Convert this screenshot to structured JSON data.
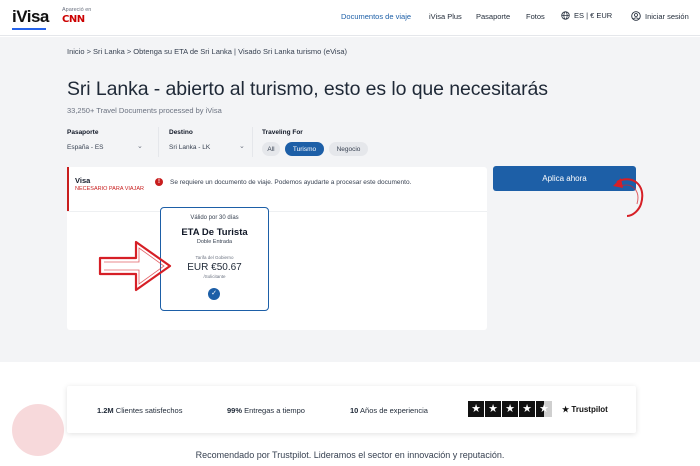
{
  "header": {
    "logo": "iVisa",
    "appeared_in": "Apareció en",
    "cnn": "CNN",
    "nav": [
      "Documentos de viaje",
      "iVisa Plus",
      "Pasaporte",
      "Fotos"
    ],
    "lang_currency": "ES | € EUR",
    "sign_in": "Iniciar sesión"
  },
  "breadcrumb": "Inicio > Sri Lanka > Obtenga su ETA de Sri Lanka | Visado Sri Lanka turismo (eVisa)",
  "page": {
    "title": "Sri Lanka - abierto al turismo, esto es lo que necesitarás",
    "subtitle": "33,250+ Travel Documents processed by iVisa"
  },
  "filters": {
    "passport_label": "Pasaporte",
    "passport_value": "España - ES",
    "destination_label": "Destino",
    "destination_value": "Sri Lanka - LK",
    "traveling_label": "Traveling For",
    "purposes": [
      "All",
      "Turismo",
      "Negocio"
    ],
    "selected_purpose": "Turismo"
  },
  "visa_card": {
    "title": "Visa",
    "required": "NECESARIO PARA VIAJAR",
    "alert": "Se requiere un documento de viaje. Podemos ayudarte a procesar este documento.",
    "option": {
      "validity": "Válido por 30 días",
      "name": "ETA De Turista",
      "entry": "Doble Entrada",
      "fee_label": "Tarifa del Gobierno",
      "price": "EUR €50.67",
      "per": "/Solicitante",
      "selected": true
    }
  },
  "apply_button": "Aplica ahora",
  "trust": {
    "clients": {
      "value": "1.2M",
      "label": "Clientes satisfechos"
    },
    "deliveries": {
      "value": "99%",
      "label": "Entregas a tiempo"
    },
    "experience": {
      "value": "10",
      "label": "Años de experiencia"
    },
    "rating_stars": 4.5,
    "trustpilot": "Trustpilot"
  },
  "recommend": "Recomendado por Trustpilot. Lideramos el sector en innovación y reputación.",
  "colors": {
    "brand_blue": "#1d5fa7",
    "alert_red": "#c81e1e",
    "page_bg": "#f3f4f6"
  }
}
